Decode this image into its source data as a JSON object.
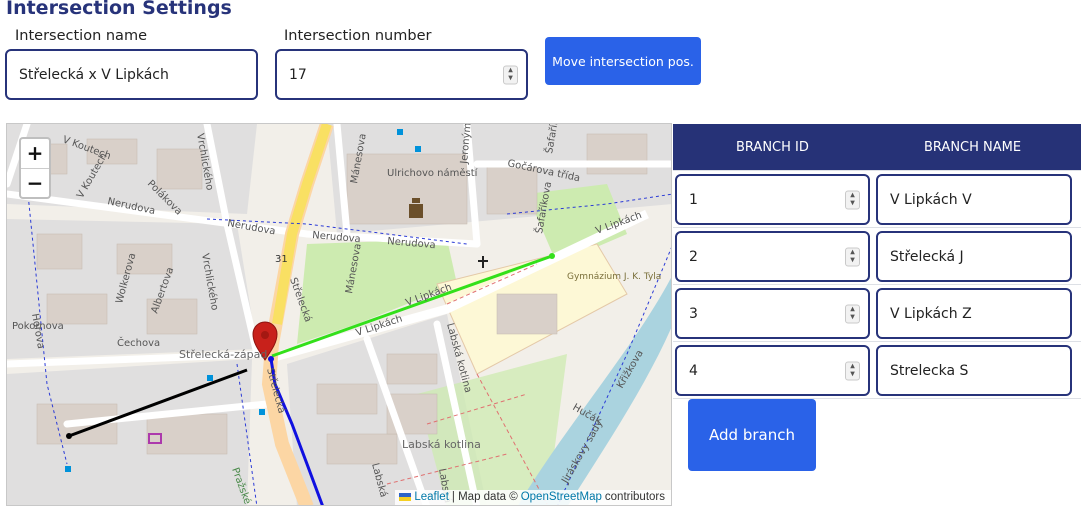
{
  "title": "Intersection Settings",
  "name_field": {
    "label": "Intersection name",
    "value": "Střelecká x V Lipkách"
  },
  "number_field": {
    "label": "Intersection number",
    "value": "17"
  },
  "move_button_label": "Move intersection pos.",
  "map": {
    "zoom_in": "+",
    "zoom_out": "−",
    "attribution": {
      "leaflet": "Leaflet",
      "separator": "| Map data ©",
      "osm": "OpenStreetMap",
      "suffix": "contributors"
    },
    "street_labels": {
      "v_koutech_1": "V Koutech",
      "v_koutech_2": "V Koutech",
      "polakova": "Polákova",
      "vrchlickeho_1": "Vrchlického",
      "vrchlickeho_2": "Vrchlického",
      "nerudova_1": "Nerudova",
      "nerudova_2": "Nerudova",
      "nerudova_3": "Nerudova",
      "nerudova_4": "Nerudova",
      "ulrichovo": "Ulrichovo náměstí",
      "gocarova": "Gočárova třída",
      "manesova_1": "Mánesova",
      "manesova_2": "Mánesova",
      "jeronymova": "Jeronýmova",
      "safarikova_1": "Šafaříkova",
      "safarikova_2": "Šafaříkova",
      "v_lipkach_1": "V Lipkách",
      "v_lipkach_2": "V Lipkách",
      "v_lipkach_3": "V Lipkách",
      "wolkerova": "Wolkerova",
      "albertova": "Albertova",
      "strelecka_1": "Střelecká",
      "strelecka_2": "Střelecká",
      "horova": "Horova",
      "cechova": "Čechova",
      "strelecka_zapad": "Střelecká-západ",
      "gymnazium": "Gymnázium J. K. Tyla",
      "labska_kotlina_1": "Labská kotlina",
      "labska_kotlina_2": "Labská kotlina",
      "labska_1": "Labská",
      "labska_2": "Labská",
      "jiraskovy_sady": "Jiráskovy sady",
      "hucak": "Hučák",
      "krizkova": "Křižkova",
      "prazske": "Pražské před",
      "pokornova": "Pokornova",
      "number_31": "31"
    }
  },
  "table": {
    "headers": [
      "BRANCH ID",
      "BRANCH NAME"
    ],
    "rows": [
      {
        "id": "1",
        "name": "V Lipkách V"
      },
      {
        "id": "2",
        "name": "Střelecká J"
      },
      {
        "id": "3",
        "name": "V Lipkách Z"
      },
      {
        "id": "4",
        "name": "Strelecka S"
      }
    ]
  },
  "add_branch_label": "Add branch",
  "colors": {
    "accent": "#27337a",
    "button": "#2a62e8",
    "branch_black": "#000000",
    "branch_blue": "#1010e0",
    "branch_green": "#33e01a",
    "primary_road": "#fcd6a4",
    "trunk_road": "#f9e063",
    "park": "#cdebb0",
    "school": "#fdf8d6",
    "river": "#aad3df",
    "marker": "#c8211b"
  },
  "icons": [
    "map-marker-icon",
    "church-icon",
    "museum-icon",
    "shopping-icon",
    "leaflet-flag-icon",
    "spin-up-icon",
    "spin-down-icon"
  ]
}
